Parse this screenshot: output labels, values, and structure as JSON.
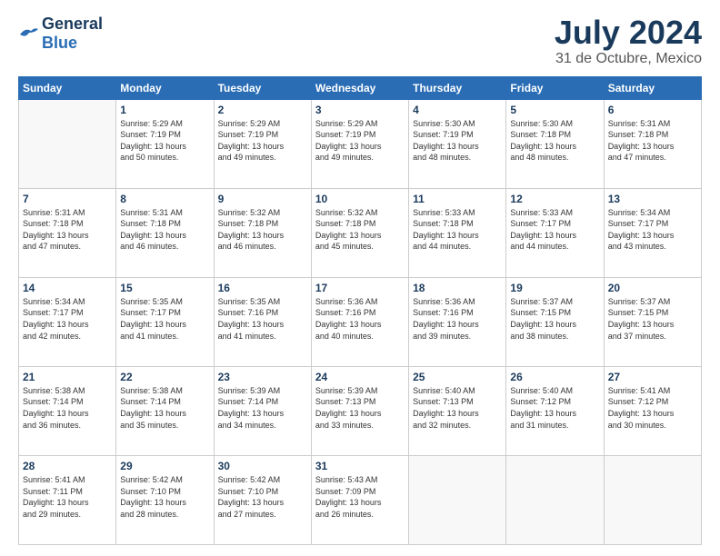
{
  "header": {
    "logo_line1": "General",
    "logo_line2": "Blue",
    "title": "July 2024",
    "subtitle": "31 de Octubre, Mexico"
  },
  "weekdays": [
    "Sunday",
    "Monday",
    "Tuesday",
    "Wednesday",
    "Thursday",
    "Friday",
    "Saturday"
  ],
  "weeks": [
    [
      {
        "day": "",
        "info": ""
      },
      {
        "day": "1",
        "info": "Sunrise: 5:29 AM\nSunset: 7:19 PM\nDaylight: 13 hours\nand 50 minutes."
      },
      {
        "day": "2",
        "info": "Sunrise: 5:29 AM\nSunset: 7:19 PM\nDaylight: 13 hours\nand 49 minutes."
      },
      {
        "day": "3",
        "info": "Sunrise: 5:29 AM\nSunset: 7:19 PM\nDaylight: 13 hours\nand 49 minutes."
      },
      {
        "day": "4",
        "info": "Sunrise: 5:30 AM\nSunset: 7:19 PM\nDaylight: 13 hours\nand 48 minutes."
      },
      {
        "day": "5",
        "info": "Sunrise: 5:30 AM\nSunset: 7:18 PM\nDaylight: 13 hours\nand 48 minutes."
      },
      {
        "day": "6",
        "info": "Sunrise: 5:31 AM\nSunset: 7:18 PM\nDaylight: 13 hours\nand 47 minutes."
      }
    ],
    [
      {
        "day": "7",
        "info": "Sunrise: 5:31 AM\nSunset: 7:18 PM\nDaylight: 13 hours\nand 47 minutes."
      },
      {
        "day": "8",
        "info": "Sunrise: 5:31 AM\nSunset: 7:18 PM\nDaylight: 13 hours\nand 46 minutes."
      },
      {
        "day": "9",
        "info": "Sunrise: 5:32 AM\nSunset: 7:18 PM\nDaylight: 13 hours\nand 46 minutes."
      },
      {
        "day": "10",
        "info": "Sunrise: 5:32 AM\nSunset: 7:18 PM\nDaylight: 13 hours\nand 45 minutes."
      },
      {
        "day": "11",
        "info": "Sunrise: 5:33 AM\nSunset: 7:18 PM\nDaylight: 13 hours\nand 44 minutes."
      },
      {
        "day": "12",
        "info": "Sunrise: 5:33 AM\nSunset: 7:17 PM\nDaylight: 13 hours\nand 44 minutes."
      },
      {
        "day": "13",
        "info": "Sunrise: 5:34 AM\nSunset: 7:17 PM\nDaylight: 13 hours\nand 43 minutes."
      }
    ],
    [
      {
        "day": "14",
        "info": "Sunrise: 5:34 AM\nSunset: 7:17 PM\nDaylight: 13 hours\nand 42 minutes."
      },
      {
        "day": "15",
        "info": "Sunrise: 5:35 AM\nSunset: 7:17 PM\nDaylight: 13 hours\nand 41 minutes."
      },
      {
        "day": "16",
        "info": "Sunrise: 5:35 AM\nSunset: 7:16 PM\nDaylight: 13 hours\nand 41 minutes."
      },
      {
        "day": "17",
        "info": "Sunrise: 5:36 AM\nSunset: 7:16 PM\nDaylight: 13 hours\nand 40 minutes."
      },
      {
        "day": "18",
        "info": "Sunrise: 5:36 AM\nSunset: 7:16 PM\nDaylight: 13 hours\nand 39 minutes."
      },
      {
        "day": "19",
        "info": "Sunrise: 5:37 AM\nSunset: 7:15 PM\nDaylight: 13 hours\nand 38 minutes."
      },
      {
        "day": "20",
        "info": "Sunrise: 5:37 AM\nSunset: 7:15 PM\nDaylight: 13 hours\nand 37 minutes."
      }
    ],
    [
      {
        "day": "21",
        "info": "Sunrise: 5:38 AM\nSunset: 7:14 PM\nDaylight: 13 hours\nand 36 minutes."
      },
      {
        "day": "22",
        "info": "Sunrise: 5:38 AM\nSunset: 7:14 PM\nDaylight: 13 hours\nand 35 minutes."
      },
      {
        "day": "23",
        "info": "Sunrise: 5:39 AM\nSunset: 7:14 PM\nDaylight: 13 hours\nand 34 minutes."
      },
      {
        "day": "24",
        "info": "Sunrise: 5:39 AM\nSunset: 7:13 PM\nDaylight: 13 hours\nand 33 minutes."
      },
      {
        "day": "25",
        "info": "Sunrise: 5:40 AM\nSunset: 7:13 PM\nDaylight: 13 hours\nand 32 minutes."
      },
      {
        "day": "26",
        "info": "Sunrise: 5:40 AM\nSunset: 7:12 PM\nDaylight: 13 hours\nand 31 minutes."
      },
      {
        "day": "27",
        "info": "Sunrise: 5:41 AM\nSunset: 7:12 PM\nDaylight: 13 hours\nand 30 minutes."
      }
    ],
    [
      {
        "day": "28",
        "info": "Sunrise: 5:41 AM\nSunset: 7:11 PM\nDaylight: 13 hours\nand 29 minutes."
      },
      {
        "day": "29",
        "info": "Sunrise: 5:42 AM\nSunset: 7:10 PM\nDaylight: 13 hours\nand 28 minutes."
      },
      {
        "day": "30",
        "info": "Sunrise: 5:42 AM\nSunset: 7:10 PM\nDaylight: 13 hours\nand 27 minutes."
      },
      {
        "day": "31",
        "info": "Sunrise: 5:43 AM\nSunset: 7:09 PM\nDaylight: 13 hours\nand 26 minutes."
      },
      {
        "day": "",
        "info": ""
      },
      {
        "day": "",
        "info": ""
      },
      {
        "day": "",
        "info": ""
      }
    ]
  ]
}
